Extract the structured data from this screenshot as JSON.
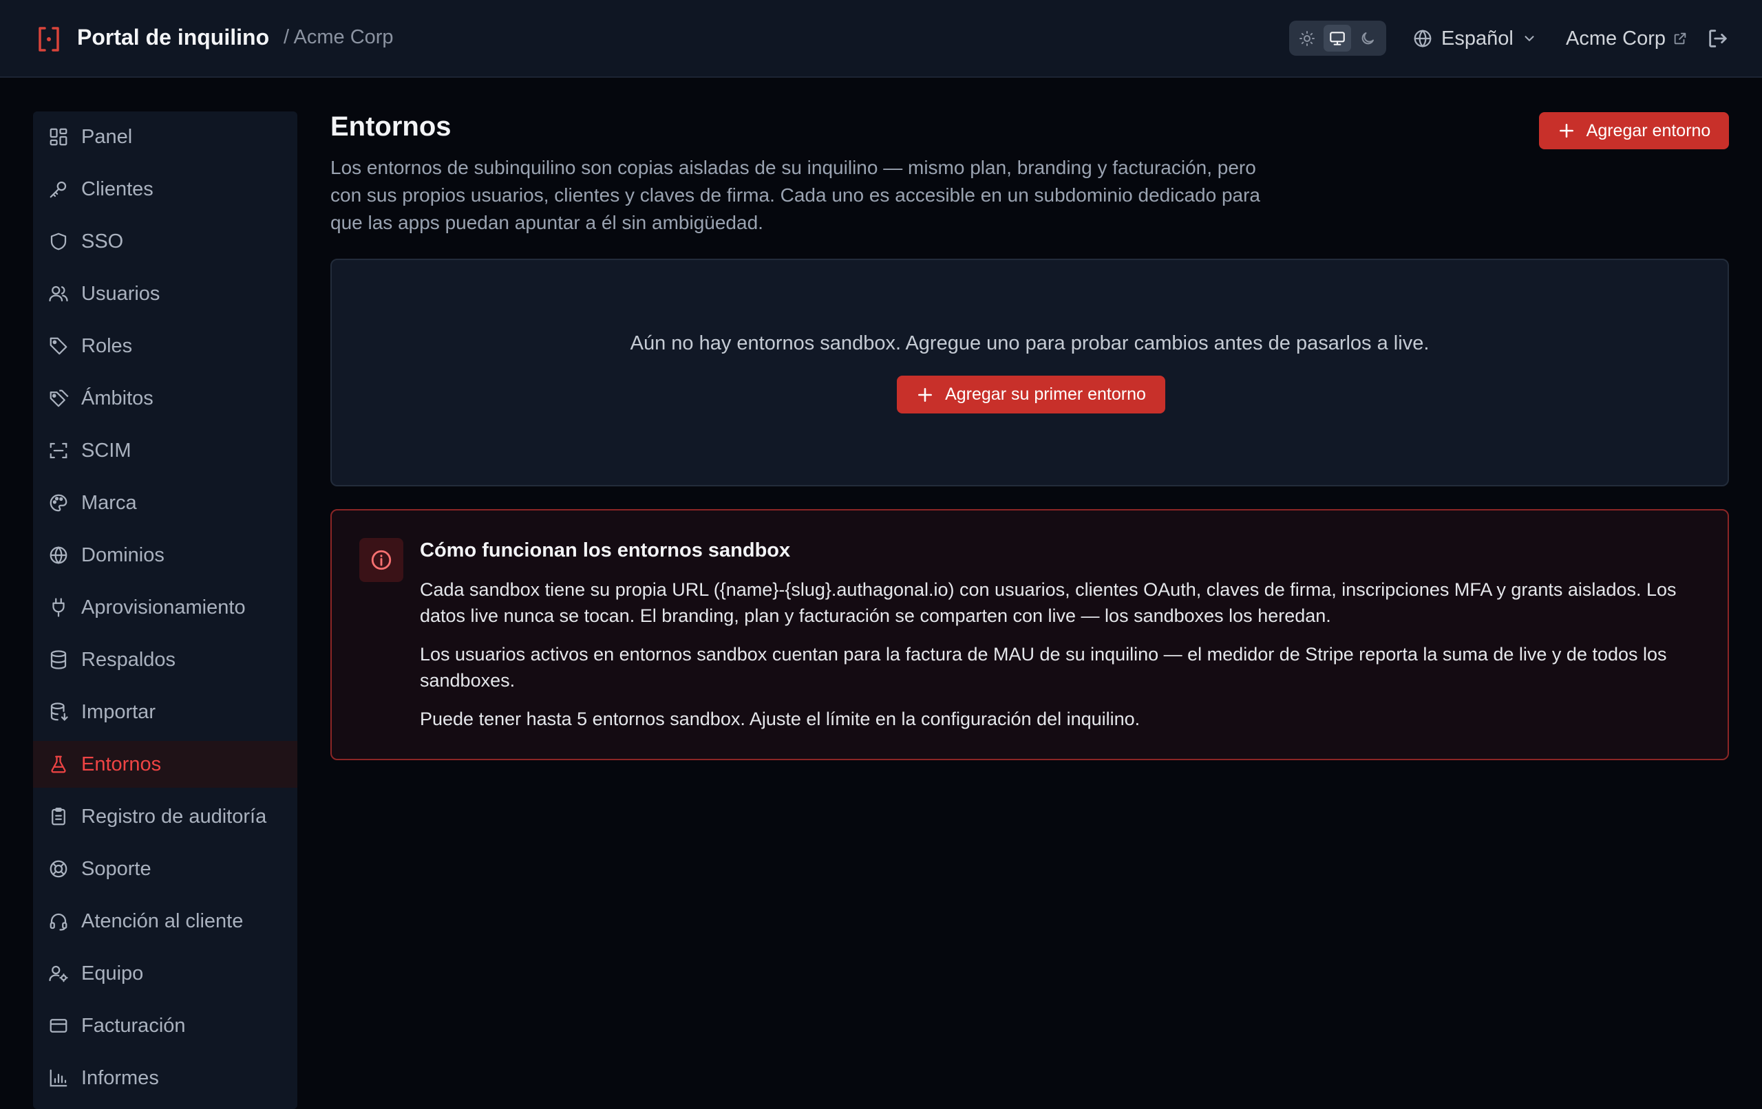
{
  "header": {
    "title": "Portal de inquilino",
    "breadcrumb": "/ Acme Corp",
    "language": "Español",
    "tenant_link": "Acme Corp",
    "theme_options": [
      "light",
      "system",
      "dark"
    ],
    "theme_selected": "system"
  },
  "sidebar": {
    "items": [
      {
        "label": "Panel",
        "icon": "dashboard-icon"
      },
      {
        "label": "Clientes",
        "icon": "key-icon"
      },
      {
        "label": "SSO",
        "icon": "shield-icon"
      },
      {
        "label": "Usuarios",
        "icon": "users-icon"
      },
      {
        "label": "Roles",
        "icon": "tag-icon"
      },
      {
        "label": "Ámbitos",
        "icon": "tags-icon"
      },
      {
        "label": "SCIM",
        "icon": "scan-icon"
      },
      {
        "label": "Marca",
        "icon": "palette-icon"
      },
      {
        "label": "Dominios",
        "icon": "globe-icon"
      },
      {
        "label": "Aprovisionamiento",
        "icon": "plug-icon"
      },
      {
        "label": "Respaldos",
        "icon": "database-icon"
      },
      {
        "label": "Importar",
        "icon": "database-import-icon"
      },
      {
        "label": "Entornos",
        "icon": "flask-icon",
        "active": true
      },
      {
        "label": "Registro de auditoría",
        "icon": "clipboard-icon"
      },
      {
        "label": "Soporte",
        "icon": "life-buoy-icon"
      },
      {
        "label": "Atención al cliente",
        "icon": "headset-icon"
      },
      {
        "label": "Equipo",
        "icon": "user-cog-icon"
      },
      {
        "label": "Facturación",
        "icon": "credit-card-icon"
      },
      {
        "label": "Informes",
        "icon": "bar-chart-icon"
      }
    ]
  },
  "main": {
    "title": "Entornos",
    "description": "Los entornos de subinquilino son copias aisladas de su inquilino — mismo plan, branding y facturación, pero con sus propios usuarios, clientes y claves de firma. Cada uno es accesible en un subdominio dedicado para que las apps puedan apuntar a él sin ambigüedad.",
    "add_button": "Agregar entorno",
    "empty_state": {
      "text": "Aún no hay entornos sandbox. Agregue uno para probar cambios antes de pasarlos a live.",
      "button": "Agregar su primer entorno"
    },
    "info": {
      "title": "Cómo funcionan los entornos sandbox",
      "paragraphs": [
        "Cada sandbox tiene su propia URL ({name}-{slug}.authagonal.io) con usuarios, clientes OAuth, claves de firma, inscripciones MFA y grants aislados. Los datos live nunca se tocan. El branding, plan y facturación se comparten con live — los sandboxes los heredan.",
        "Los usuarios activos en entornos sandbox cuentan para la factura de MAU de su inquilino — el medidor de Stripe reporta la suma de live y de todos los sandboxes.",
        "Puede tener hasta 5 entornos sandbox. Ajuste el límite en la configuración del inquilino."
      ]
    }
  },
  "colors": {
    "accent": "#c8302a",
    "active_text": "#ef4444",
    "background": "#05070d",
    "panel": "#0f1623"
  }
}
